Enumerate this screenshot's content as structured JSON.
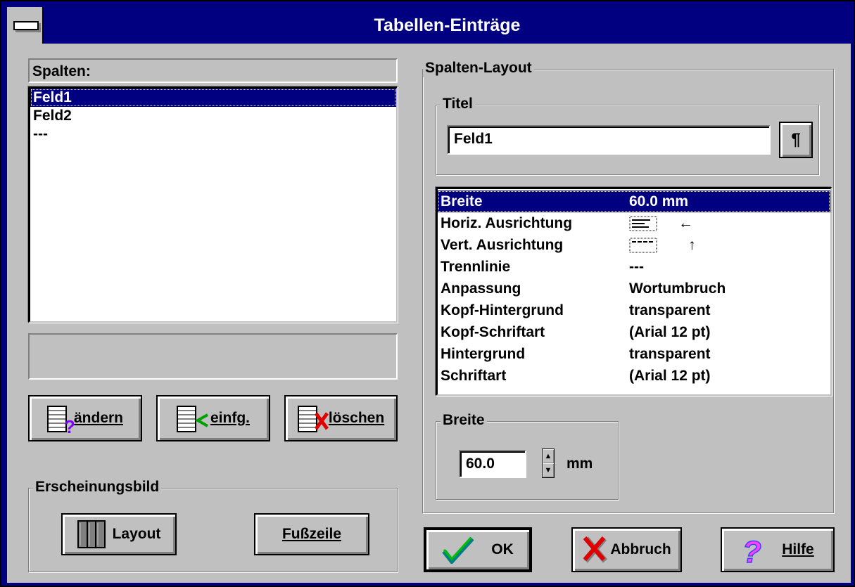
{
  "window": {
    "title": "Tabellen-Einträge"
  },
  "left": {
    "columns_label": "Spalten:",
    "columns": [
      "Feld1",
      "Feld2",
      "---"
    ],
    "selected_index": 0,
    "buttons": {
      "edit": "ändern",
      "insert": "einfg.",
      "delete": "löschen"
    },
    "appearance_group": "Erscheinungsbild",
    "layout_button": "Layout",
    "footer_button": "Fußzeile"
  },
  "right": {
    "layout_group": "Spalten-Layout",
    "title_group": "Titel",
    "title_value": "Feld1",
    "paragraph_button": "¶",
    "properties": [
      {
        "key": "Breite",
        "value": "60.0 mm"
      },
      {
        "key": "Horiz. Ausrichtung",
        "value": "←"
      },
      {
        "key": "Vert. Ausrichtung",
        "value": "↑"
      },
      {
        "key": "Trennlinie",
        "value": "---"
      },
      {
        "key": "Anpassung",
        "value": "Wortumbruch"
      },
      {
        "key": "Kopf-Hintergrund",
        "value": "transparent"
      },
      {
        "key": "Kopf-Schriftart",
        "value": "(Arial 12 pt)"
      },
      {
        "key": "Hintergrund",
        "value": "transparent"
      },
      {
        "key": "Schriftart",
        "value": "(Arial 12 pt)"
      }
    ],
    "width_group": "Breite",
    "width_value": "60.0",
    "width_unit": "mm"
  },
  "footer": {
    "ok": "OK",
    "cancel": "Abbruch",
    "help": "Hilfe"
  },
  "colors": {
    "titlebar": "#000080",
    "face": "#c0c0c0",
    "selection": "#000080"
  }
}
